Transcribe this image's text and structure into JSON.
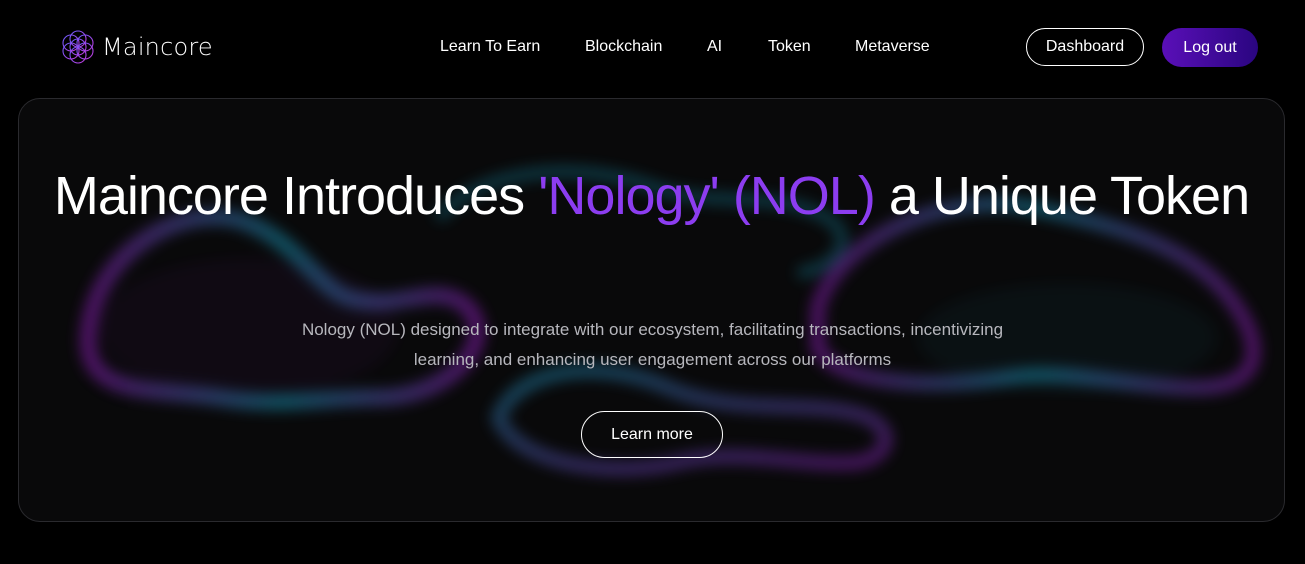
{
  "brand": {
    "name": "Maincore",
    "logo_icon": "sacred-geometry-logo-icon"
  },
  "nav": {
    "items": [
      {
        "label": "Learn To Earn"
      },
      {
        "label": "Blockchain"
      },
      {
        "label": "AI"
      },
      {
        "label": "Token"
      },
      {
        "label": "Metaverse"
      }
    ]
  },
  "header_actions": {
    "dashboard_label": "Dashboard",
    "logout_label": "Log out"
  },
  "hero": {
    "title_before": "Maincore Introduces ",
    "title_highlight": "'Nology' (NOL)",
    "title_after": " a Unique Token",
    "description": "Nology (NOL) designed to integrate with our ecosystem, facilitating transactions, incentivizing learning, and enhancing user engagement across our platforms",
    "cta_label": "Learn more"
  },
  "colors": {
    "background": "#000000",
    "accent": "#8c3df0",
    "button_gradient_start": "#5a0fb8",
    "button_gradient_end": "#2a0580",
    "blob_cyan": "#1aa6c8",
    "blob_magenta": "#a01fd0"
  }
}
